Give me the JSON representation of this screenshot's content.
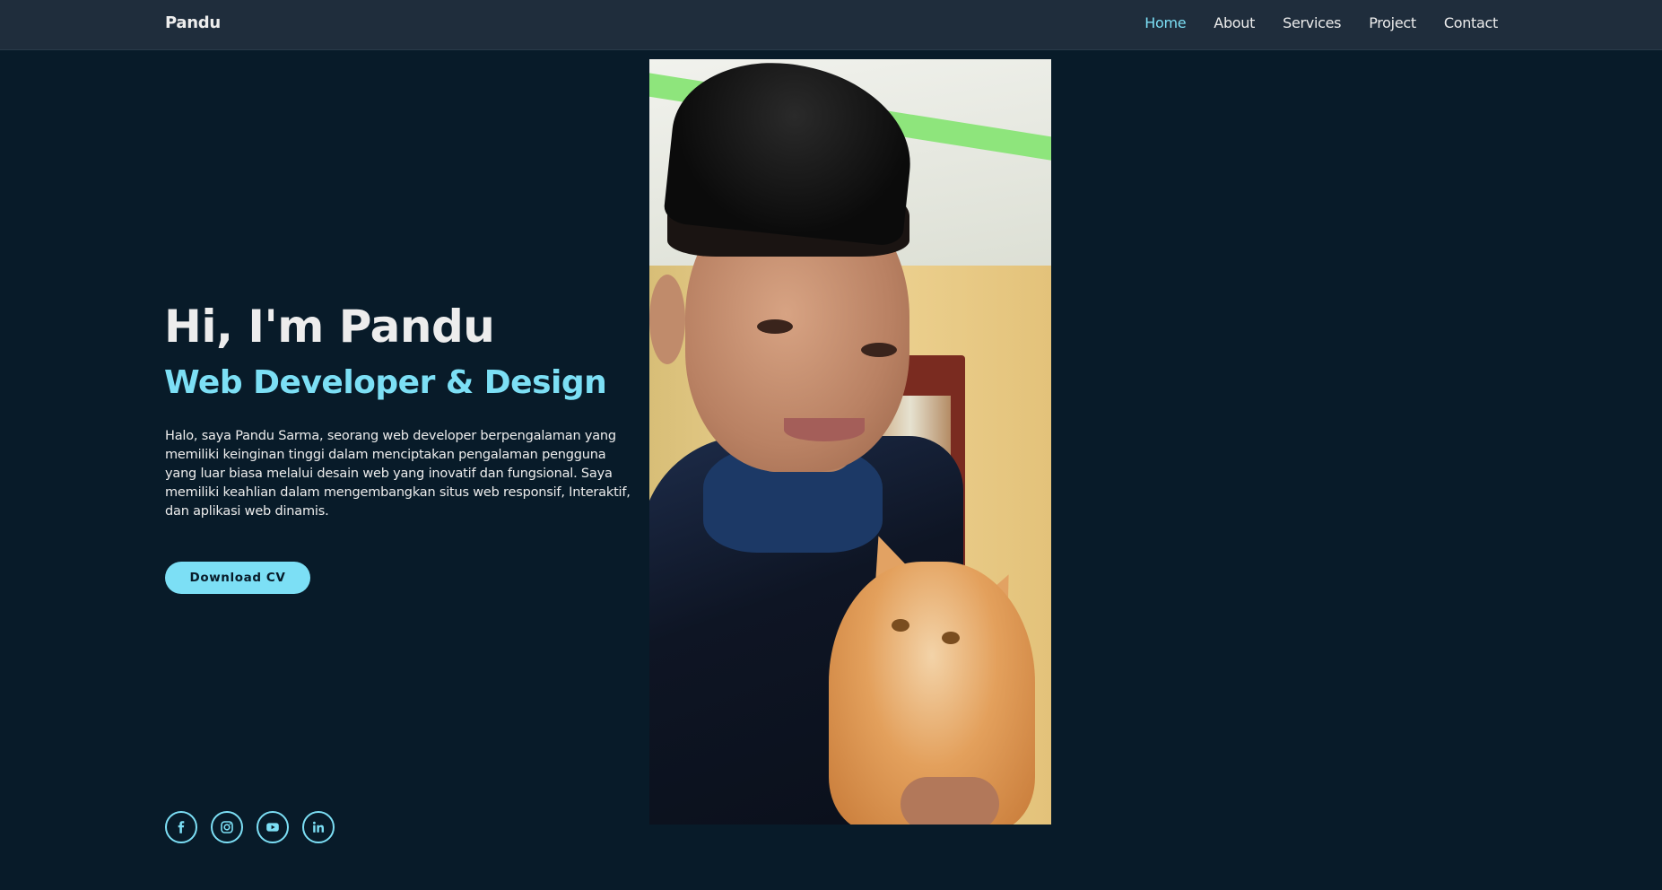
{
  "navbar": {
    "logo": "Pandu",
    "links": [
      {
        "label": "Home",
        "active": true
      },
      {
        "label": "About",
        "active": false
      },
      {
        "label": "Services",
        "active": false
      },
      {
        "label": "Project",
        "active": false
      },
      {
        "label": "Contact",
        "active": false
      }
    ]
  },
  "hero": {
    "title": "Hi, I'm Pandu",
    "subtitle": "Web Developer & Design",
    "description": "Halo, saya Pandu Sarma, seorang web developer berpengalaman yang memiliki keinginan tinggi dalam menciptakan pengalaman pengguna yang luar biasa melalui desain web yang inovatif dan fungsional. Saya memiliki keahlian dalam mengembangkan situs web responsif, Interaktif, dan aplikasi web dinamis.",
    "cv_button": "Download CV"
  },
  "socials": [
    {
      "icon": "facebook-icon"
    },
    {
      "icon": "instagram-icon"
    },
    {
      "icon": "youtube-icon"
    },
    {
      "icon": "linkedin-icon"
    }
  ],
  "colors": {
    "background": "#081b29",
    "navbar": "#1f2d3c",
    "accent": "#7cdff5",
    "text": "#ededed"
  }
}
